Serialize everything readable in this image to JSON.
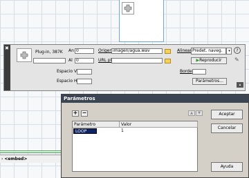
{
  "inspector": {
    "plugin_label": "Plug-in, 387K",
    "an_label": "An",
    "an_value": "0",
    "al_label": "Al",
    "al_value": "0",
    "origen_label": "Origen",
    "origen_value": "imagen/agua.wav",
    "url_label": "URL plg",
    "url_value": "",
    "alinear_label": "Alinear",
    "alinear_value": "Predet. naveg.",
    "reproducir_label": "Reproducir",
    "espacio_v_label": "Espacio V",
    "espacio_v_value": "",
    "espacio_h_label": "Espacio H",
    "espacio_h_value": "",
    "borde_label": "Borde",
    "borde_value": "",
    "parametros_button": "Parámetros..."
  },
  "status_bar": {
    "tag": "<embed>"
  },
  "dialog": {
    "title": "Parámetros",
    "add_label": "+",
    "remove_label": "−",
    "columns": [
      "Parámetro",
      "Valor"
    ],
    "rows": [
      {
        "param": "LOOP",
        "value": "1"
      }
    ],
    "ok_label": "Aceptar",
    "cancel_label": "Cancelar",
    "help_label": "Ayuda"
  }
}
